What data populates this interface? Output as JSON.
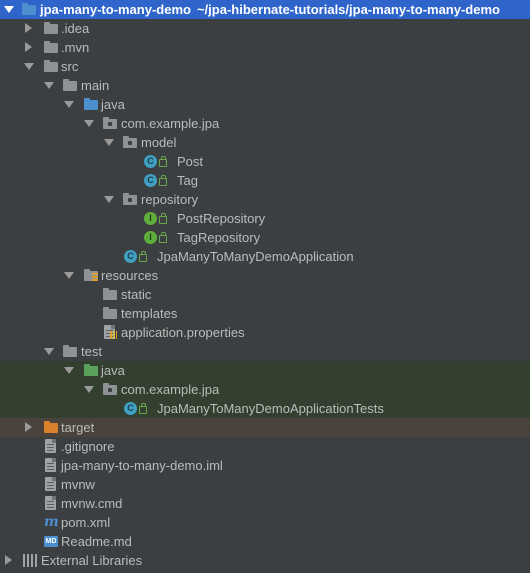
{
  "project": {
    "name": "jpa-many-to-many-demo",
    "path": "~/jpa-hibernate-tutorials/jpa-many-to-many-demo"
  },
  "tree": {
    "idea": ".idea",
    "mvn": ".mvn",
    "src": "src",
    "main": "main",
    "java_main": "java",
    "pkg_main": "com.example.jpa",
    "model": "model",
    "post": "Post",
    "tag": "Tag",
    "repository": "repository",
    "post_repo": "PostRepository",
    "tag_repo": "TagRepository",
    "app_class": "JpaManyToManyDemoApplication",
    "resources": "resources",
    "static": "static",
    "templates": "templates",
    "app_props": "application.properties",
    "test": "test",
    "java_test": "java",
    "pkg_test": "com.example.jpa",
    "app_tests": "JpaManyToManyDemoApplicationTests",
    "target": "target",
    "gitignore": ".gitignore",
    "iml": "jpa-many-to-many-demo.iml",
    "mvnw": "mvnw",
    "mvnw_cmd": "mvnw.cmd",
    "pom": "pom.xml",
    "readme": "Readme.md",
    "external_libs": "External Libraries"
  },
  "icons": {
    "class_letter": "C",
    "interface_letter": "I",
    "maven_letter": "m",
    "md_letters": "MD"
  },
  "colors": {
    "background": "#3c3f41",
    "selection": "#2f65ca",
    "test_highlight": "#33402f",
    "excluded_highlight": "#49433b",
    "source_folder": "#4c8fcf",
    "test_folder": "#5aa15a",
    "excluded_folder": "#d9822b"
  }
}
